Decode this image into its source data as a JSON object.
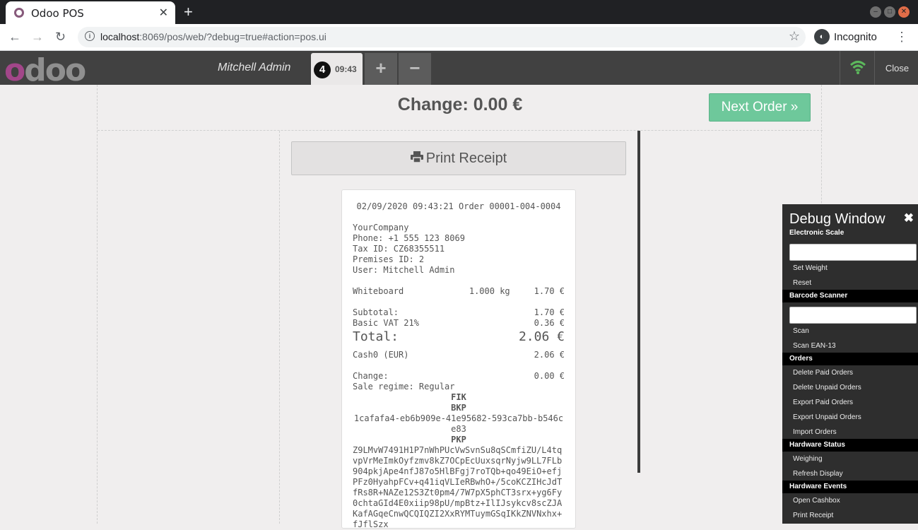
{
  "browser": {
    "tab_title": "Odoo POS",
    "url_host": "localhost",
    "url_rest": ":8069/pos/web/?debug=true#action=pos.ui",
    "profile_label": "Incognito"
  },
  "header": {
    "logo_first": "o",
    "logo_rest": "doo",
    "user": "Mitchell Admin",
    "order_number": "4",
    "order_time": "09:43",
    "add_symbol": "+",
    "remove_symbol": "−",
    "close_label": "Close"
  },
  "screen": {
    "change_title": "Change: 0.00 €",
    "next_order_label": "Next Order »",
    "print_label": "Print Receipt"
  },
  "receipt": {
    "header_line": "02/09/2020 09:43:21 Order 00001-004-0004",
    "company": "YourCompany",
    "phone": "Phone: +1 555 123 8069",
    "tax_id": "Tax ID: CZ68355511",
    "premises": "Premises ID: 2",
    "user": "User: Mitchell Admin",
    "lines": [
      {
        "product": "Whiteboard",
        "qty": "1.000 kg",
        "price": "1.70 €"
      }
    ],
    "subtotal_label": "Subtotal:",
    "subtotal_value": "1.70 €",
    "tax_label": "Basic VAT 21%",
    "tax_value": "0.36 €",
    "total_label": "Total:",
    "total_value": "2.06 €",
    "payment_label": "Cash0 (EUR)",
    "payment_value": "2.06 €",
    "change_label": "Change:",
    "change_value": "0.00 €",
    "regime": "Sale regime: Regular",
    "fik_label": "FIK",
    "bkp_label": "BKP",
    "bkp_value": "1cafafa4-eb6b909e-41e95682-593ca7bb-b546ce83",
    "pkp_label": "PKP",
    "pkp_value": "Z9LMvW7491H1P7nWhPUcVwSvnSu8qSCmfiZU/L4tqvpVrMeImkOyfzmv8kZ7OCpEcUuxsqrNyjw9LL7FLb904pkjApe4nfJ87o5HlBFgj7roTQb+qo49EiO+efjPFz0HyahpFCv+q41iqVLIeRBwhO+/5coKCZIHcJdTfRs8R+NAZe12S3Zt0pm4/7W7pX5phCT3srx+yg6Fy0chtaGId4E0xiip98pU/mpBtz+IlIJsykcv8scZJAKafAGqeCnwQCQIQZI2XxRYMTuymGSqIKkZNVNxhx+fJflSzx"
  },
  "debug": {
    "title": "Debug Window",
    "scale_section": "Electronic Scale",
    "set_weight": "Set Weight",
    "reset": "Reset",
    "barcode_section": "Barcode Scanner",
    "scan": "Scan",
    "scan_ean": "Scan EAN-13",
    "orders_section": "Orders",
    "delete_paid": "Delete Paid Orders",
    "delete_unpaid": "Delete Unpaid Orders",
    "export_paid": "Export Paid Orders",
    "export_unpaid": "Export Unpaid Orders",
    "import_orders": "Import Orders",
    "hw_status_section": "Hardware Status",
    "weighing": "Weighing",
    "refresh_display": "Refresh Display",
    "hw_events_section": "Hardware Events",
    "open_cashbox": "Open Cashbox",
    "print_receipt": "Print Receipt"
  }
}
